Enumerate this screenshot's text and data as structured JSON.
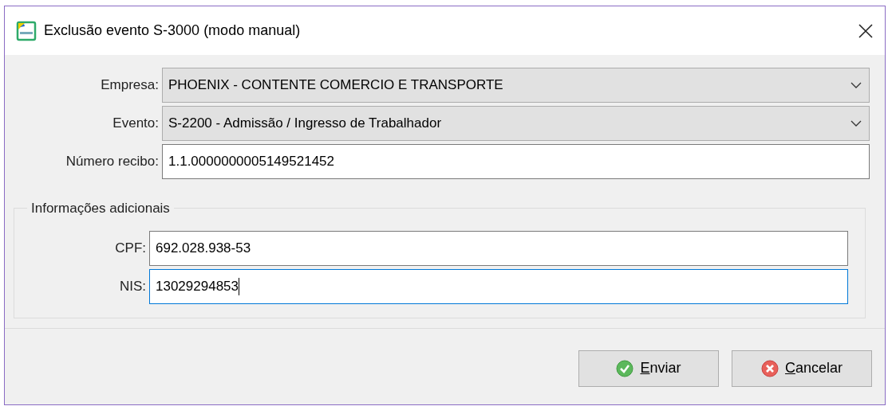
{
  "window": {
    "title": "Exclusão evento S-3000 (modo manual)"
  },
  "fields": [
    {
      "kind": "combo",
      "label": "Empresa:",
      "value": "PHOENIX - CONTENTE COMERCIO E TRANSPORTE",
      "focused": false
    },
    {
      "kind": "combo",
      "label": "Evento:",
      "value": "S-2200 - Admissão / Ingresso de Trabalhador",
      "focused": false
    },
    {
      "kind": "text",
      "label": "Número recibo:",
      "value": "1.1.0000000005149521452",
      "focused": false
    }
  ],
  "group": {
    "title": "Informações adicionais",
    "fields": [
      {
        "kind": "text",
        "label": "CPF:",
        "value": "692.028.938-53",
        "focused": false
      },
      {
        "kind": "text",
        "label": "NIS:",
        "value": "13029294853",
        "focused": true
      }
    ]
  },
  "buttons": [
    {
      "kind": "ok",
      "label": "Enviar"
    },
    {
      "kind": "cancel",
      "label": "Cancelar"
    }
  ]
}
